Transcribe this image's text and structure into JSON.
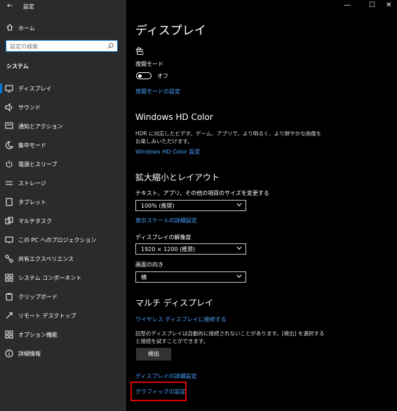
{
  "window": {
    "title": "設定"
  },
  "sidebar": {
    "home_label": "ホーム",
    "search_placeholder": "設定の検索",
    "section_title": "システム",
    "items": [
      {
        "label": "ディスプレイ",
        "icon": "monitor-icon",
        "selected": true
      },
      {
        "label": "サウンド",
        "icon": "speaker-icon"
      },
      {
        "label": "通知とアクション",
        "icon": "notification-icon"
      },
      {
        "label": "集中モード",
        "icon": "moon-icon"
      },
      {
        "label": "電源とスリープ",
        "icon": "power-icon"
      },
      {
        "label": "ストレージ",
        "icon": "storage-icon"
      },
      {
        "label": "タブレット",
        "icon": "tablet-icon"
      },
      {
        "label": "マルチタスク",
        "icon": "multitask-icon"
      },
      {
        "label": "この PC へのプロジェクション",
        "icon": "projection-icon"
      },
      {
        "label": "共有エクスペリエンス",
        "icon": "shared-experience-icon"
      },
      {
        "label": "システム コンポーネント",
        "icon": "components-icon"
      },
      {
        "label": "クリップボード",
        "icon": "clipboard-icon"
      },
      {
        "label": "リモート デスクトップ",
        "icon": "remote-desktop-icon"
      },
      {
        "label": "オプション機能",
        "icon": "optional-features-icon"
      },
      {
        "label": "詳細情報",
        "icon": "info-icon"
      }
    ]
  },
  "main": {
    "title": "ディスプレイ",
    "color": {
      "heading": "色",
      "night_mode_label": "夜間モード",
      "toggle_state": "オフ",
      "night_mode_link": "夜間モードの設定"
    },
    "hd_color": {
      "heading": "Windows HD Color",
      "description": "HDR に対応したビデオ、ゲーム、アプリで、より明るく、より鮮やかな画像をお楽しみいただけます。",
      "link": "Windows HD Color 設定"
    },
    "scale_layout": {
      "heading": "拡大縮小とレイアウト",
      "scale_label": "テキスト、アプリ、その他の項目のサイズを変更する",
      "scale_value": "100% (推奨)",
      "advanced_scale_link": "表示スケールの詳細設定",
      "resolution_label": "ディスプレイの解像度",
      "resolution_value": "1920 × 1200 (推奨)",
      "orientation_label": "画面の向き",
      "orientation_value": "横"
    },
    "multi_display": {
      "heading": "マルチ ディスプレイ",
      "wireless_link": "ワイヤレス ディスプレイに接続する",
      "description": "旧型のディスプレイは自動的に接続されないことがあります。[検出] を選択すると接続を試すことができます。",
      "detect_button": "検出",
      "advanced_display_link": "ディスプレイの詳細設定",
      "graphics_link": "グラフィックの設定"
    }
  },
  "colors": {
    "accent": "#0078d7",
    "link": "#4aa3ff",
    "highlight": "#e00000"
  }
}
